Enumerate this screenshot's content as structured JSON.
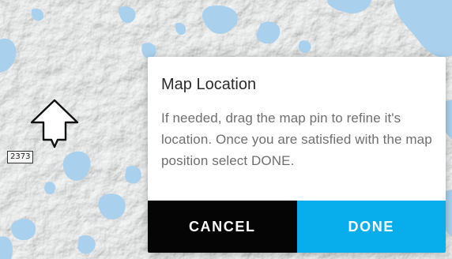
{
  "map": {
    "road_shield_label": "2373",
    "pin_icon": "map-pin-icon",
    "colors": {
      "land": "#e9eaea",
      "water": "#a9d0ec"
    }
  },
  "dialog": {
    "title": "Map Location",
    "message": "If needed, drag the map pin to refine it's location. Once you are satisfied with the map position select DONE.",
    "cancel_label": "CANCEL",
    "done_label": "DONE",
    "colors": {
      "cancel_bg": "#050505",
      "done_bg": "#07aeeb"
    }
  }
}
